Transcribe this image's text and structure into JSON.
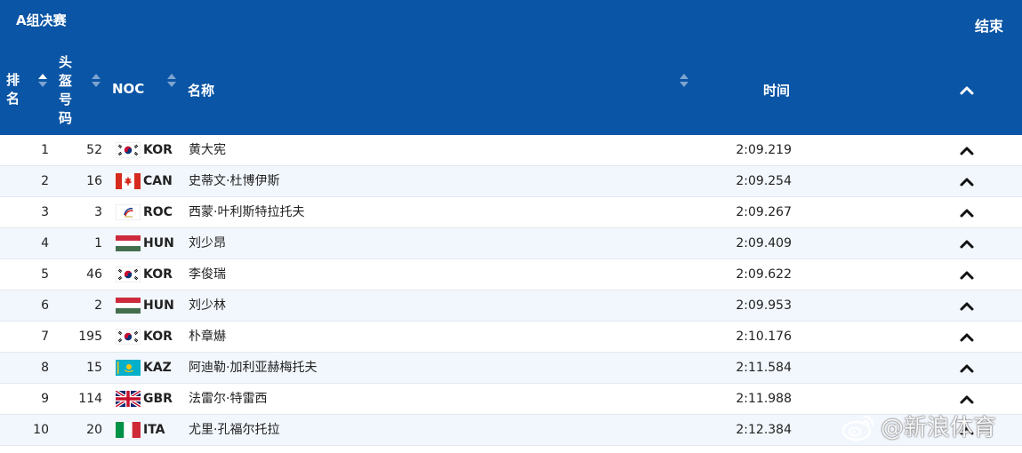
{
  "header": {
    "title": "A组决赛",
    "status": "结束",
    "columns": {
      "rank": "排名",
      "bib": "头盔号码",
      "noc": "NOC",
      "name": "名称",
      "time": "时间"
    }
  },
  "rows": [
    {
      "rank": "1",
      "bib": "52",
      "noc": "KOR",
      "flag": "kor-flag-icon",
      "name": "黄大宪",
      "time": "2:09.219"
    },
    {
      "rank": "2",
      "bib": "16",
      "noc": "CAN",
      "flag": "can-flag-icon",
      "name": "史蒂文·杜博伊斯",
      "time": "2:09.254"
    },
    {
      "rank": "3",
      "bib": "3",
      "noc": "ROC",
      "flag": "roc-flag-icon",
      "name": "西蒙·叶利斯特拉托夫",
      "time": "2:09.267"
    },
    {
      "rank": "4",
      "bib": "1",
      "noc": "HUN",
      "flag": "hun-flag-icon",
      "name": "刘少昂",
      "time": "2:09.409"
    },
    {
      "rank": "5",
      "bib": "46",
      "noc": "KOR",
      "flag": "kor-flag-icon",
      "name": "李俊瑞",
      "time": "2:09.622"
    },
    {
      "rank": "6",
      "bib": "2",
      "noc": "HUN",
      "flag": "hun-flag-icon",
      "name": "刘少林",
      "time": "2:09.953"
    },
    {
      "rank": "7",
      "bib": "195",
      "noc": "KOR",
      "flag": "kor-flag-icon",
      "name": "朴章爀",
      "time": "2:10.176"
    },
    {
      "rank": "8",
      "bib": "15",
      "noc": "KAZ",
      "flag": "kaz-flag-icon",
      "name": "阿迪勒·加利亚赫梅托夫",
      "time": "2:11.584"
    },
    {
      "rank": "9",
      "bib": "114",
      "noc": "GBR",
      "flag": "gbr-flag-icon",
      "name": "法雷尔·特雷西",
      "time": "2:11.988"
    },
    {
      "rank": "10",
      "bib": "20",
      "noc": "ITA",
      "flag": "ita-flag-icon",
      "name": "尤里·孔福尔托拉",
      "time": "2:12.384"
    }
  ],
  "watermark": {
    "text": "@新浪体育",
    "icon": "weibo-logo-icon"
  },
  "colors": {
    "header_bg": "#0a55a5",
    "row_alt_bg": "#f2f7fd",
    "text": "#222222"
  }
}
